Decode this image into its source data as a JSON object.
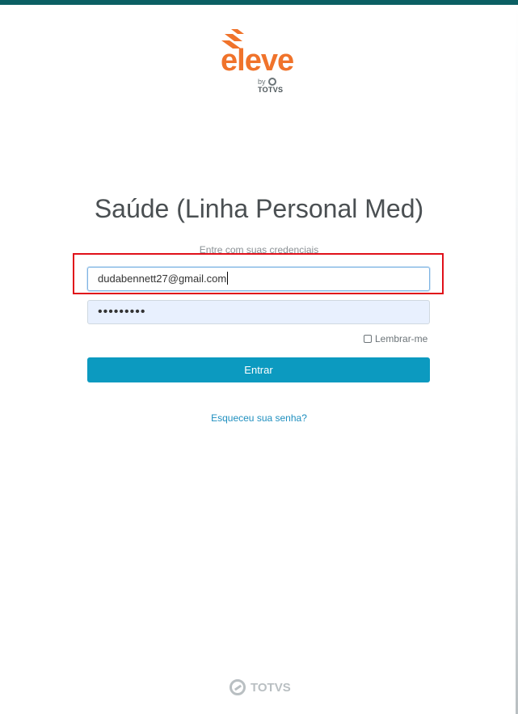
{
  "brand": {
    "logo_text": "eleve",
    "by_text": "by",
    "by_company": "TOTVS"
  },
  "login": {
    "title": "Saúde (Linha Personal Med)",
    "subtitle": "Entre com suas credenciais",
    "email_value": "dudabennett27@gmail.com",
    "password_value": "•••••••••",
    "remember_label": "Lembrar-me",
    "submit_label": "Entrar",
    "forgot_link": "Esqueceu sua senha?"
  },
  "footer": {
    "brand": "TOTVS"
  },
  "colors": {
    "top_bar": "#0b5f63",
    "logo_orange": "#f0732b",
    "button": "#0c9ac0",
    "link": "#1f8fbf",
    "highlight": "#e0101a"
  }
}
